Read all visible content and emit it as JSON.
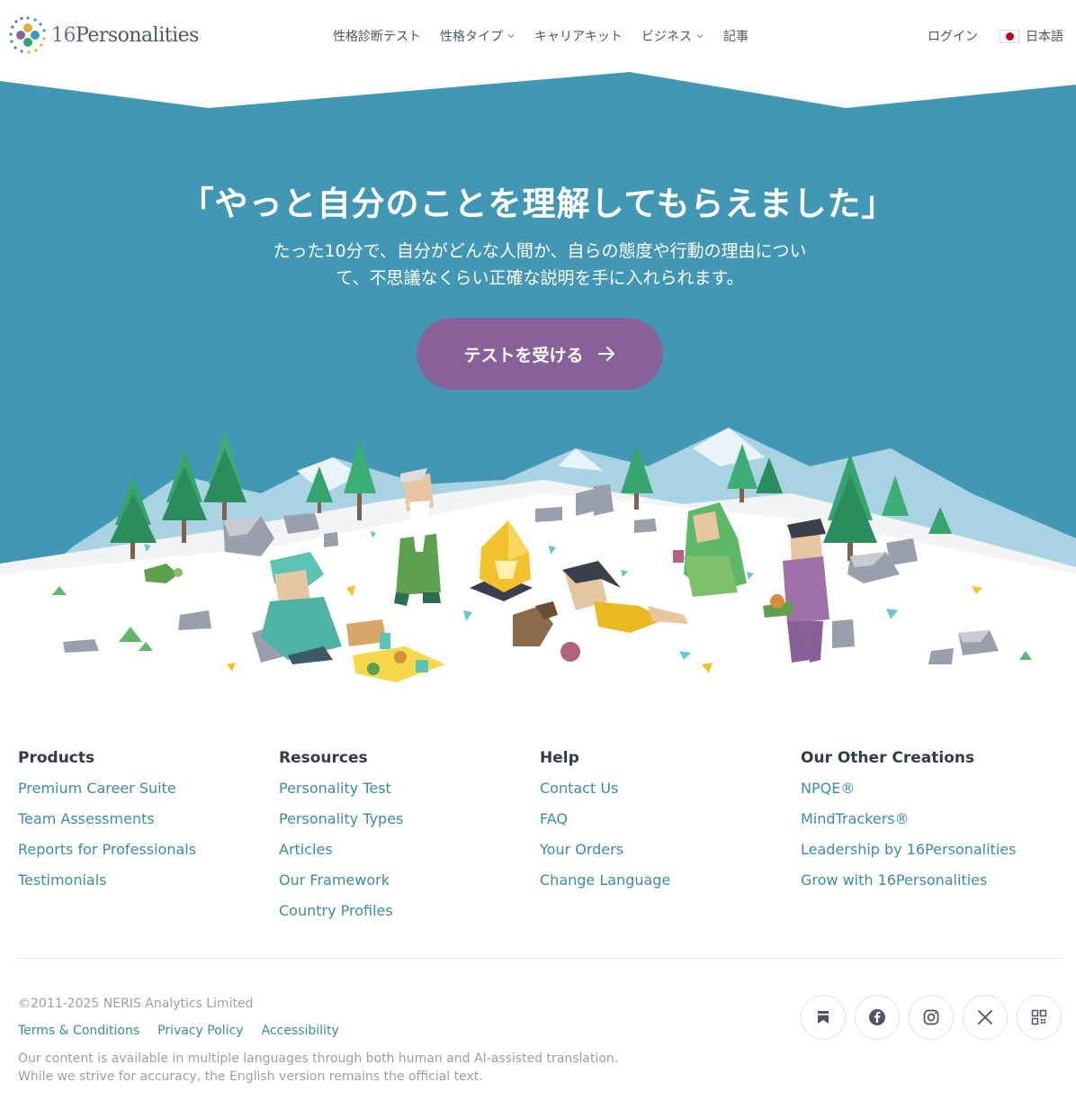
{
  "header": {
    "logo_number": "16",
    "logo_word": "Personalities",
    "nav": [
      {
        "label": "性格診断テスト"
      },
      {
        "label": "性格タイプ"
      },
      {
        "label": "キャリアキット"
      },
      {
        "label": "ビジネス"
      },
      {
        "label": "記事"
      }
    ],
    "login": "ログイン",
    "language": "日本語"
  },
  "hero": {
    "title": "「やっと自分のことを理解してもらえました」",
    "subtitle": "たった10分で、自分がどんな人間か、自らの態度や行動の理由について、不思議なくらい正確な説明を手に入れられます。",
    "cta": "テストを受ける"
  },
  "footer": {
    "columns": [
      {
        "heading": "Products",
        "links": [
          "Premium Career Suite",
          "Team Assessments",
          "Reports for Professionals",
          "Testimonials"
        ]
      },
      {
        "heading": "Resources",
        "links": [
          "Personality Test",
          "Personality Types",
          "Articles",
          "Our Framework",
          "Country Profiles"
        ]
      },
      {
        "heading": "Help",
        "links": [
          "Contact Us",
          "FAQ",
          "Your Orders",
          "Change Language"
        ]
      },
      {
        "heading": "Our Other Creations",
        "links": [
          "NPQE®",
          "MindTrackers®",
          "Leadership by 16Personalities",
          "Grow with 16Personalities"
        ]
      }
    ],
    "copyright": "©2011-2025 NERIS Analytics Limited",
    "legal": [
      "Terms & Conditions",
      "Privacy Policy",
      "Accessibility"
    ],
    "disclaimer": "Our content is available in multiple languages through both human and AI-assisted translation. While we strive for accuracy, the English version remains the official text.",
    "socials": [
      "bookmark-icon",
      "facebook-icon",
      "instagram-icon",
      "x-icon",
      "qr-code-icon"
    ]
  },
  "colors": {
    "hero_blue": "#4297b5",
    "brand_purple": "#88619a",
    "link_teal": "#3c8d9f",
    "text_dark": "#343c4b"
  }
}
